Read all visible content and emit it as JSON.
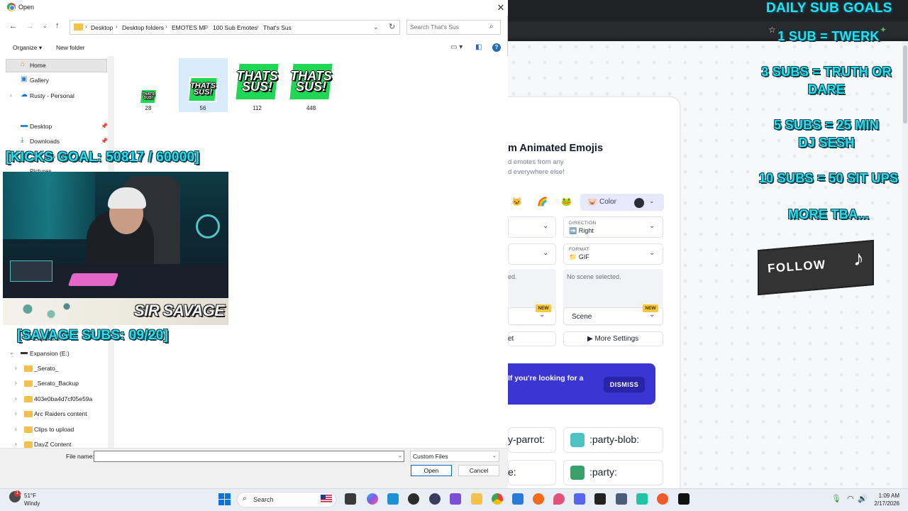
{
  "dialog": {
    "title": "Open",
    "breadcrumbs": [
      "Desktop",
      "Desktop folders",
      "EMOTES MF",
      "100 Sub Emotes",
      "That's Sus"
    ],
    "search_placeholder": "Search That's Sus",
    "organize_label": "Organize",
    "new_folder_label": "New folder",
    "nav_items": {
      "home": "Home",
      "gallery": "Gallery",
      "personal": "Rusty - Personal",
      "desktop": "Desktop",
      "downloads": "Downloads",
      "partial1": "ents",
      "partial2": "Pictures",
      "partial3": "Expansion",
      "expansion_drive": "Expansion (E:)",
      "serato": "_Serato_",
      "serato_backup": "_Serato_Backup",
      "hash_folder": "403e0ba4d7cf05e59a",
      "arc_raiders": "Arc Raiders content",
      "clips": "Clips to upload",
      "dayz": "DayZ Content"
    },
    "files": [
      {
        "label": "28",
        "emote_line1": "THATS",
        "emote_line2": "SUS!"
      },
      {
        "label": "56",
        "emote_line1": "THATS",
        "emote_line2": "SUS!"
      },
      {
        "label": "112",
        "emote_line1": "THATS",
        "emote_line2": "SUS!"
      },
      {
        "label": "448",
        "emote_line1": "THATS",
        "emote_line2": "SUS!"
      }
    ],
    "filename_label": "File name:",
    "filename_value": "",
    "filetype_value": "Custom Files",
    "open_label": "Open",
    "cancel_label": "Cancel"
  },
  "webpage": {
    "title_partial": "m Animated Emojis",
    "subtitle_line1": "d emotes from any",
    "subtitle_line2": "d everywhere else!",
    "color_label": "Color",
    "direction_caption": "DIRECTION",
    "direction_value": "Right",
    "format_caption": "FORMAT",
    "format_value": "GIF",
    "scene_left_text": "ed.",
    "scene_right_text": "No scene selected.",
    "new_badge": "NEW",
    "scene_label": "Scene",
    "partial_button": "et",
    "more_settings": "More Settings",
    "banner_text": "If you're looking for a",
    "dismiss_label": "DISMISS",
    "emotes": {
      "left_top": "y-parrot:",
      "right_top": ":party-blob:",
      "left_bottom": "e:",
      "right_bottom": ":party:"
    }
  },
  "overlay": {
    "daily_title": "DAILY SUB GOALS",
    "goal1": "1 SUB = TWERK",
    "goal3a": "3 SUBS = TRUTH OR",
    "goal3b": "DARE",
    "goal5a": "5 SUBS = 25 MIN",
    "goal5b": "DJ SESH",
    "goal10": "10 SUBS = 50 SIT UPS",
    "more": "MORE TBA...",
    "follow": "FOLLOW",
    "kicks_goal": "[KICKS GOAL: 50817 / 60000]",
    "brand": "SIR SAVAGE",
    "savage_subs": "[SAVAGE SUBS: 09/20]"
  },
  "taskbar": {
    "temp": "51°F",
    "condition": "Windy",
    "weather_badge": "1",
    "search_label": "Search",
    "time": "1:09 AM",
    "date": "2/17/2026"
  },
  "colors": {
    "accent": "#0067c0",
    "overlay_cyan": "#27e0ee",
    "emote_green": "#1fd655",
    "banner_purple": "#3b35d4"
  }
}
